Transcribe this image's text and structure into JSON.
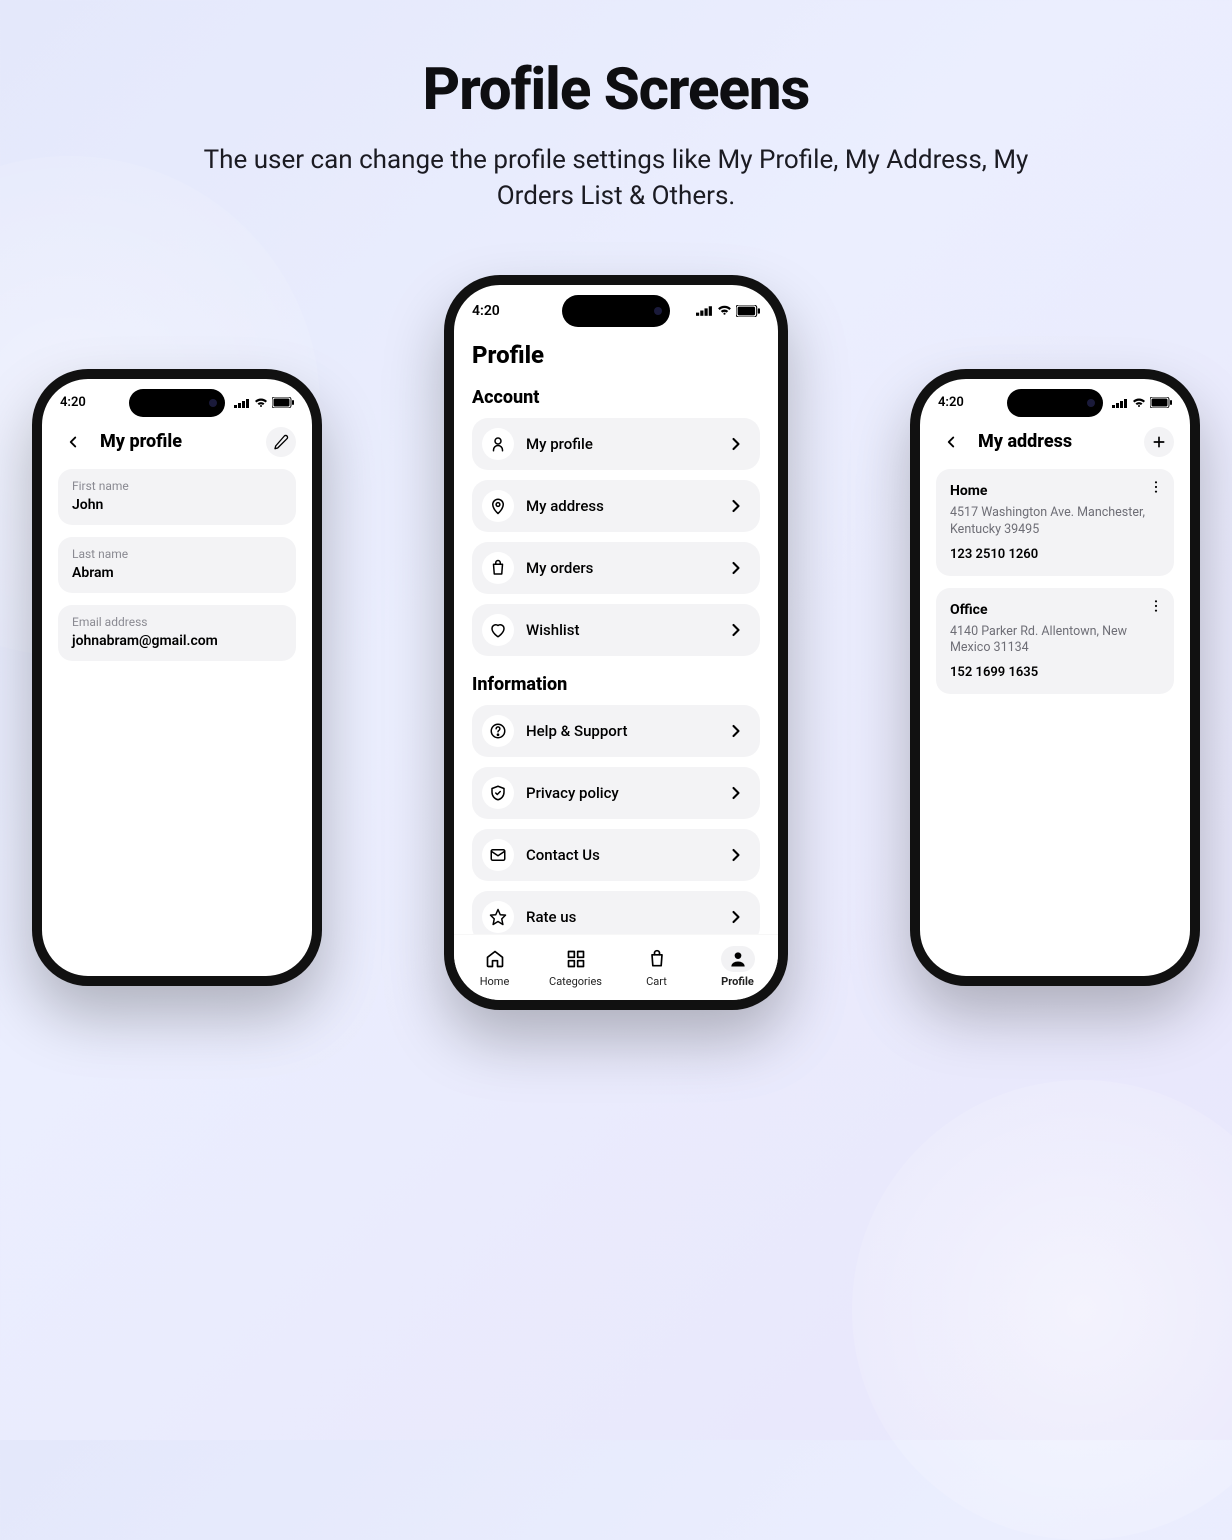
{
  "page": {
    "title": "Profile Screens",
    "subtitle": "The user can change the profile settings like My Profile, My Address, My Orders List & Others."
  },
  "status": {
    "time": "4:20"
  },
  "left": {
    "title": "My profile",
    "first_name_label": "First name",
    "first_name_value": "John",
    "last_name_label": "Last name",
    "last_name_value": "Abram",
    "email_label": "Email address",
    "email_value": "johnabram@gmail.com"
  },
  "center": {
    "title": "Profile",
    "section_account": "Account",
    "section_information": "Information",
    "items_account": [
      {
        "label": "My profile"
      },
      {
        "label": "My address"
      },
      {
        "label": "My orders"
      },
      {
        "label": "Wishlist"
      }
    ],
    "items_info": [
      {
        "label": "Help & Support"
      },
      {
        "label": "Privacy policy"
      },
      {
        "label": "Contact Us"
      },
      {
        "label": "Rate us"
      }
    ],
    "tabs": {
      "home": "Home",
      "categories": "Categories",
      "cart": "Cart",
      "profile": "Profile"
    }
  },
  "right": {
    "title": "My address",
    "addresses": [
      {
        "name": "Home",
        "line": "4517 Washington Ave. Manchester, Kentucky 39495",
        "phone": "123 2510 1260"
      },
      {
        "name": "Office",
        "line": "4140 Parker Rd. Allentown, New Mexico 31134",
        "phone": "152 1699 1635"
      }
    ]
  }
}
